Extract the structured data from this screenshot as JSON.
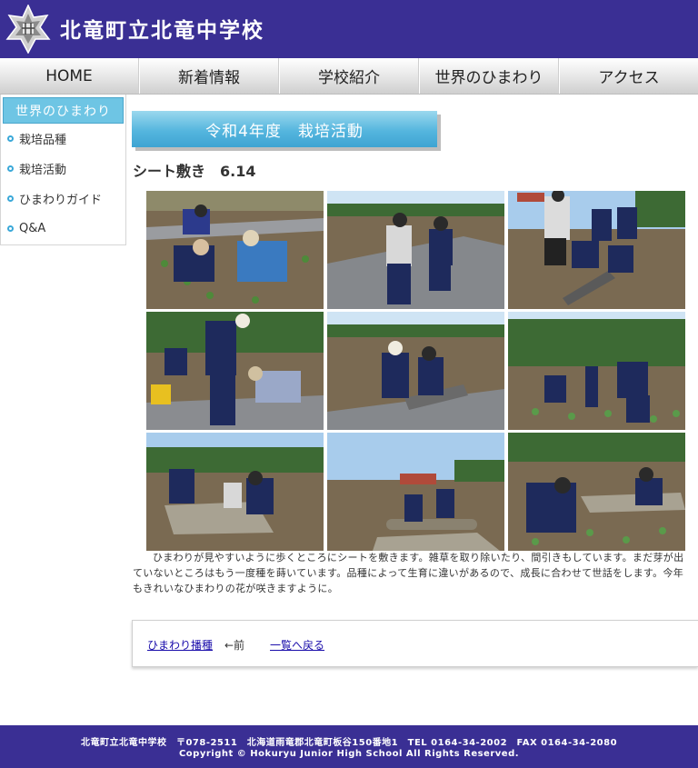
{
  "header": {
    "title": "北竜町立北竜中学校"
  },
  "nav": {
    "items": [
      "HOME",
      "新着情報",
      "学校紹介",
      "世界のひまわり",
      "アクセス"
    ]
  },
  "sidebar": {
    "heading": "世界のひまわり",
    "items": [
      "栽培品種",
      "栽培活動",
      "ひまわりガイド",
      "Q&A"
    ]
  },
  "main": {
    "title": "令和4年度　栽培活動",
    "subtitle": "シート敷き　6.14",
    "body": "ひまわりが見やすいように歩くところにシートを敷きます。雑草を取り除いたり、間引きもしています。まだ芽が出ていないところはもう一度種を蒔いています。品種によって生育に違いがあるので、成長に合わせて世話をします。今年もきれいなひまわりの花が咲きますように。"
  },
  "pager": {
    "prev_link": "ひまわり播種",
    "prev_label": "←前",
    "list_link": "一覧へ戻る"
  },
  "footer": {
    "line1": "北竜町立北竜中学校　〒078-2511　北海道雨竜郡北竜町板谷150番地1　TEL 0164-34-2002　FAX 0164-34-2080",
    "line2": "Copyright © Hokuryu Junior High School All Rights Reserved."
  },
  "colors": {
    "brand": "#3a2f94",
    "accent": "#55b6de",
    "link": "#1a0dab"
  }
}
